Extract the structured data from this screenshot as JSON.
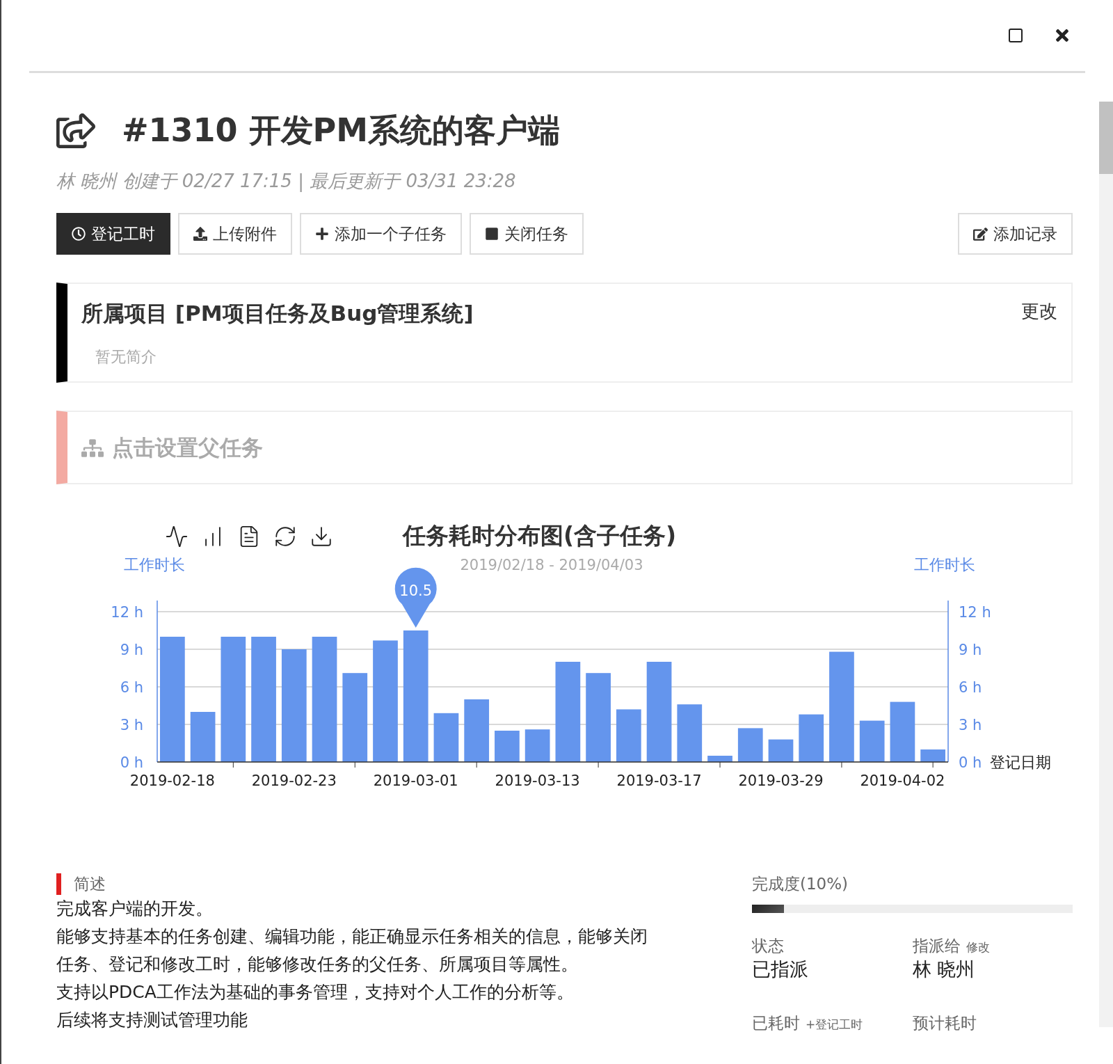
{
  "task": {
    "title": "#1310 开发PM系统的客户端",
    "meta": "林 晓州 创建于 02/27 17:15 | 最后更新于 03/31 23:28"
  },
  "actions": [
    {
      "label": "登记工时",
      "kind": "primary"
    },
    {
      "label": "上传附件",
      "kind": "default"
    },
    {
      "label": "添加一个子任务",
      "kind": "default"
    },
    {
      "label": "关闭任务",
      "kind": "default"
    }
  ],
  "record_button": {
    "label": "添加记录"
  },
  "project": {
    "title": "所属项目 [PM项目任务及Bug管理系统]",
    "change": "更改",
    "intro": "暂无简介"
  },
  "parent_task": {
    "label": "点击设置父任务"
  },
  "chart": {
    "title": "任务耗时分布图(含子任务)",
    "subtitle": "2019/02/18 - 2019/04/03",
    "mark_label": "10.5",
    "chart_data": {
      "type": "bar",
      "ylabel": "工作时长",
      "xlabel": "登记日期",
      "grid": true,
      "categories": [
        "2019-02-18",
        null,
        null,
        null,
        "2019-02-23",
        null,
        null,
        null,
        "2019-03-01",
        null,
        null,
        null,
        "2019-03-13",
        null,
        null,
        null,
        "2019-03-17",
        null,
        null,
        null,
        "2019-03-29",
        null,
        null,
        null,
        "2019-04-02",
        null
      ],
      "series": [
        {
          "name": "工作时长",
          "color": "#6495ed",
          "values": [
            10,
            4,
            10,
            10,
            9,
            10,
            7.1,
            9.7,
            10.5,
            3.9,
            5,
            2.5,
            2.6,
            8,
            7.1,
            4.2,
            8,
            4.6,
            0.5,
            2.7,
            1.8,
            3.8,
            8.8,
            3.3,
            4.8,
            1
          ]
        }
      ],
      "ylim": [
        0,
        12
      ],
      "yticks": [
        {
          "value": 0,
          "label": "0 h"
        },
        {
          "value": 3,
          "label": "3 h"
        },
        {
          "value": 6,
          "label": "6 h"
        },
        {
          "value": 9,
          "label": "9 h"
        },
        {
          "value": 12,
          "label": "12 h"
        }
      ]
    }
  },
  "summary": {
    "heading": "简述",
    "lines": [
      "完成客户端的开发。",
      "能够支持基本的任务创建、编辑功能，能正确显示任务相关的信息，能够关闭",
      "任务、登记和修改工时，能够修改任务的父任务、所属项目等属性。",
      "支持以PDCA工作法为基础的事务管理，支持对个人工作的分析等。",
      "后续将支持测试管理功能"
    ]
  },
  "progress": {
    "label": "完成度(10%)",
    "level": 0.1
  },
  "fields": [
    {
      "label": "状态",
      "value": "已指派"
    },
    {
      "label": "指派给",
      "action": "修改",
      "value": "林 晓州"
    },
    {
      "label": "已耗时",
      "action": "+登记工时"
    },
    {
      "label": "预计耗时"
    }
  ]
}
